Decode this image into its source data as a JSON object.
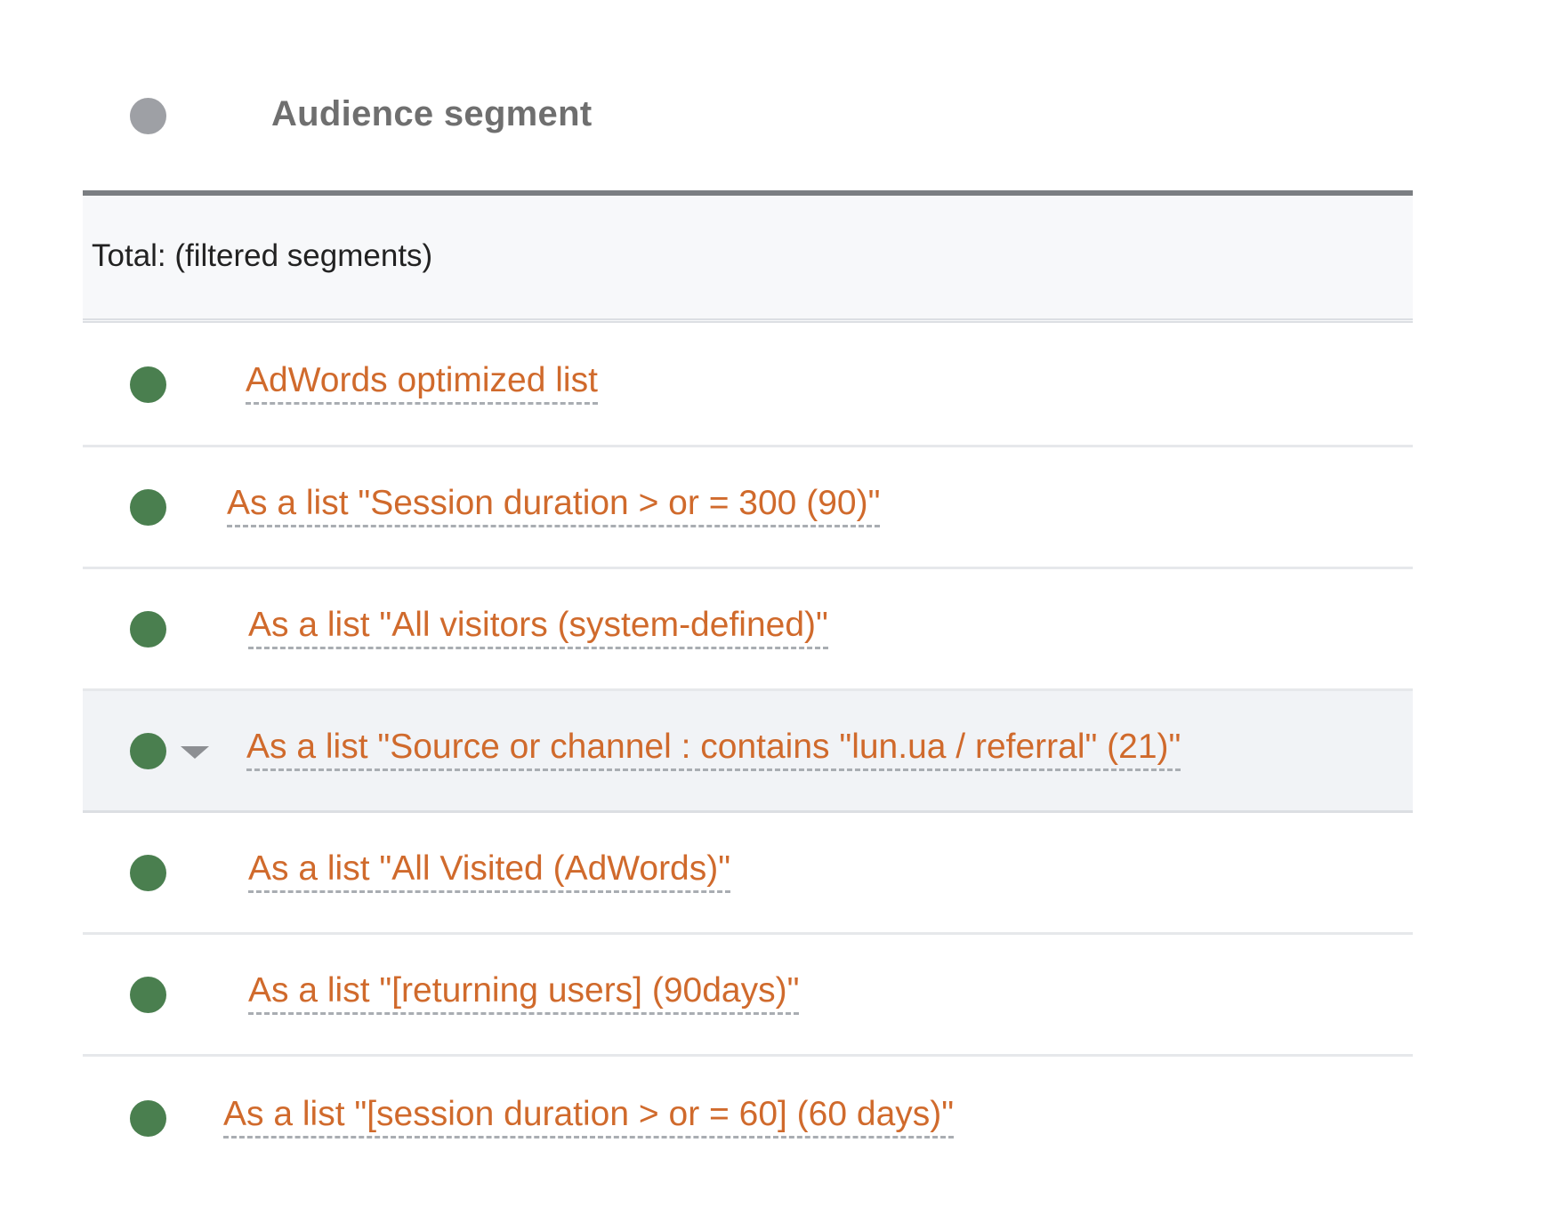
{
  "header": {
    "title": "Audience segment"
  },
  "total": {
    "label": "Total: (filtered segments)"
  },
  "segments": [
    {
      "label": "AdWords optimized list"
    },
    {
      "label": "As a list \"Session duration > or = 300 (90)\""
    },
    {
      "label": "As a list \"All visitors (system-defined)\""
    },
    {
      "label": "As a list \"Source or channel : contains \"lun.ua / referral\" (21)\""
    },
    {
      "label": "As a list \"All Visited (AdWords)\""
    },
    {
      "label": "As a list \"[returning users] (90days)\""
    },
    {
      "label": "As a list \"[session duration > or = 60] (60 days)\""
    }
  ],
  "colors": {
    "status_active": "#4a7f4f",
    "status_header": "#9ea0a5",
    "link": "#d06a2c"
  },
  "icons": {
    "status": "status-dot-icon",
    "expand": "caret-down-icon"
  }
}
